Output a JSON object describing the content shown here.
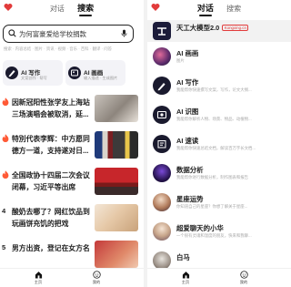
{
  "left": {
    "tabs": [
      "对话",
      "搜索"
    ],
    "active_tab": "搜索",
    "search": {
      "text": "为何富豪爱给学校捐款"
    },
    "sub_hint": "搜索 · 内容总结 · 图片 · 资讯 · 视频 · 音乐 · 百科 · 翻译 · 问答",
    "cards": [
      {
        "title": "AI 写作",
        "sub": "文案创作 · 帮写"
      },
      {
        "title": "AI 画画",
        "sub": "输入描述 · 生成图片"
      }
    ],
    "news": [
      {
        "marker": "fire",
        "title": "因新冠阳性张学友上海站三场演唱会被取消，延...",
        "meta": "新浪新闻 · 3小时前"
      },
      {
        "marker": "fire",
        "title": "特別代表李辉：中方愿同德方一道，支持遂对日...",
        "meta": "环球网 · 5小时前"
      },
      {
        "marker": "fire",
        "title": "全国政协十四届二次会议闭幕，习近平等出席",
        "meta": "人民网 · 6小时前"
      },
      {
        "marker": "4",
        "title": "酸奶去哪了？网红饮品到玩画饼充饥的把戏",
        "meta": "澎湃新闻 · 8小时前"
      },
      {
        "marker": "5",
        "title": "男方出资，登记在女方名",
        "meta": ""
      }
    ],
    "bottom": [
      {
        "label": "主页"
      },
      {
        "label": "我的"
      }
    ]
  },
  "right": {
    "tabs": [
      "对话",
      "搜索"
    ],
    "active_tab": "对话",
    "chats": [
      {
        "name": "天工大模型2.0",
        "badge": "Kongxing.cn",
        "desc": ""
      },
      {
        "name": "AI 画画",
        "desc": "图片"
      },
      {
        "name": "AI 写作",
        "desc": "我能帮你快速撰写文案，写作，论文大纲..."
      },
      {
        "name": "AI 识图",
        "desc": "我能帮你解析人物、场景、物品、动植物..."
      },
      {
        "name": "AI 速读",
        "desc": "我能帮你快速总结文档，解读百万字长文档..."
      },
      {
        "name": "数据分析",
        "desc": "我能帮你进行数据分析，制作图表和报告"
      },
      {
        "name": "星座运势",
        "desc": "你知道自己的星座？你想了解关于星座..."
      },
      {
        "name": "超爱聊天的小华",
        "desc": "一个很有灵魂和温度的朋友，快来和我聊..."
      },
      {
        "name": "白马",
        "desc": ""
      }
    ],
    "bottom": [
      {
        "label": "主页"
      },
      {
        "label": "我的"
      }
    ]
  },
  "colors": {
    "accent_red": "#e23b3b",
    "fire": "#ff5a36",
    "text": "#222222"
  }
}
